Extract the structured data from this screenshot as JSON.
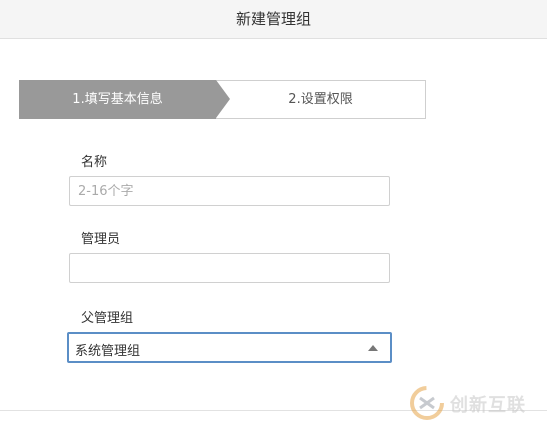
{
  "dialog": {
    "title": "新建管理组"
  },
  "steps": [
    {
      "label": "1.填写基本信息",
      "state": "active"
    },
    {
      "label": "2.设置权限",
      "state": "pending"
    }
  ],
  "form": {
    "name": {
      "label": "名称",
      "value": "",
      "placeholder": "2-16个字"
    },
    "admin": {
      "label": "管理员",
      "value": "",
      "placeholder": ""
    },
    "parent_group": {
      "label": "父管理组",
      "selected": "系统管理组"
    }
  },
  "watermark": {
    "text": "创新互联"
  },
  "colors": {
    "active_step": "#999999",
    "focus_border": "#5b8ec6"
  }
}
